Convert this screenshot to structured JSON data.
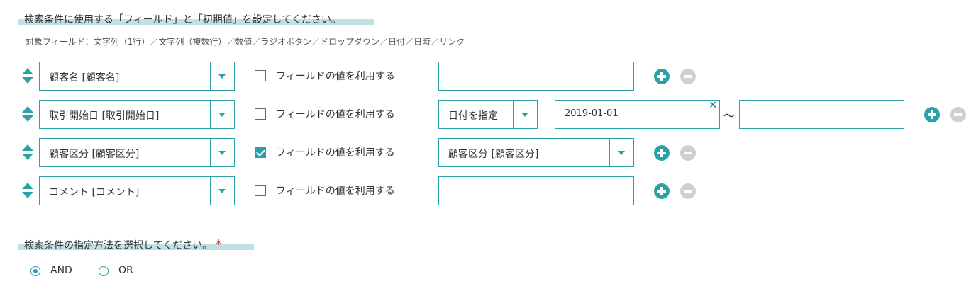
{
  "fields_section": {
    "heading": "検索条件に使用する「フィールド」と「初期値」を設定してください。",
    "description": "対象フィールド：文字列（1行）／文字列（複数行）／数値／ラジオボタン／ドロップダウン／日付／日時／リンク",
    "accent_color": "#2aa1a6",
    "highlight_color": "#bfe1e1",
    "rows": [
      {
        "field": "顧客名 [顧客名]",
        "use_field_value_label": "フィールドの値を利用する",
        "use_field_value": false,
        "value": ""
      },
      {
        "field": "取引開始日 [取引開始日]",
        "use_field_value_label": "フィールドの値を利用する",
        "use_field_value": false,
        "date_mode": "日付を指定",
        "date_from": "2019-01-01",
        "range_separator": "～",
        "date_to": ""
      },
      {
        "field": "顧客区分 [顧客区分]",
        "use_field_value_label": "フィールドの値を利用する",
        "use_field_value": true,
        "value_field": "顧客区分 [顧客区分]"
      },
      {
        "field": "コメント [コメント]",
        "use_field_value_label": "フィールドの値を利用する",
        "use_field_value": false,
        "value": ""
      }
    ],
    "icons": {
      "sort": "sort-arrows-icon",
      "add": "plus-circle-icon",
      "remove": "minus-circle-icon",
      "clear": "close-icon"
    }
  },
  "method_section": {
    "heading": "検索条件の指定方法を選択してください。",
    "required_mark": "*",
    "options": [
      {
        "label": "AND",
        "selected": true
      },
      {
        "label": "OR",
        "selected": false
      }
    ]
  }
}
